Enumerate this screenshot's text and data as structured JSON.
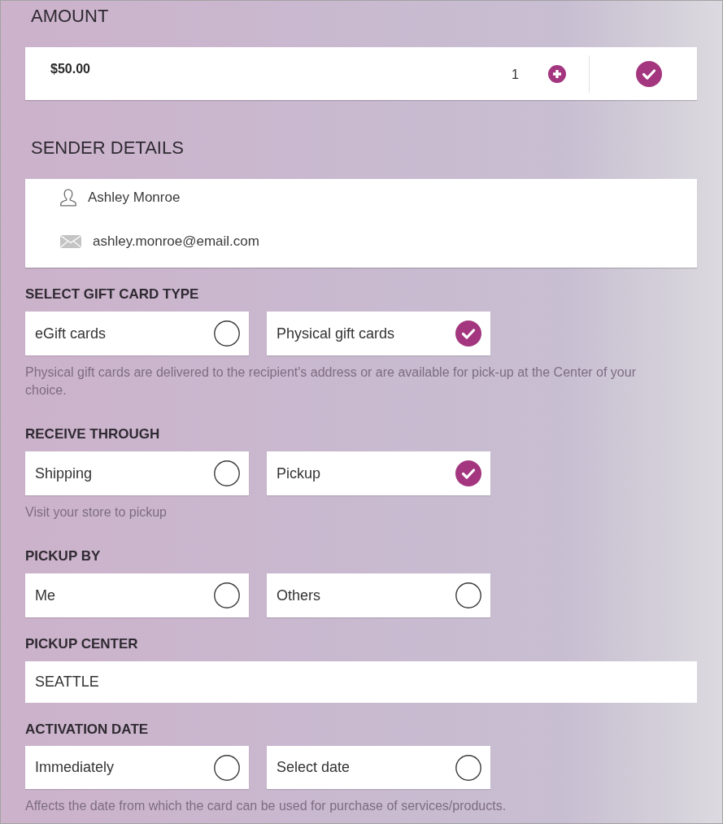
{
  "amount": {
    "heading": "AMOUNT",
    "value": "$50.00",
    "quantity": "1",
    "selected": true
  },
  "sender": {
    "heading": "SENDER DETAILS",
    "name": "Ashley Monroe",
    "email": "ashley.monroe@email.com"
  },
  "sections": [
    {
      "kind": "options",
      "heading": "SELECT GIFT CARD TYPE",
      "options": [
        {
          "label": "eGift cards",
          "selected": false
        },
        {
          "label": "Physical gift cards",
          "selected": true
        }
      ],
      "note": "Physical gift cards are delivered to the recipient's address or are available for pick-up at the Center of your choice."
    },
    {
      "kind": "options",
      "heading": "RECEIVE THROUGH",
      "options": [
        {
          "label": "Shipping",
          "selected": false
        },
        {
          "label": "Pickup",
          "selected": true
        }
      ],
      "note": "Visit your store to pickup"
    },
    {
      "kind": "options",
      "heading": "PICKUP BY",
      "options": [
        {
          "label": "Me",
          "selected": false
        },
        {
          "label": "Others",
          "selected": false
        }
      ]
    },
    {
      "kind": "field",
      "heading": "PICKUP CENTER",
      "value": "SEATTLE"
    },
    {
      "kind": "options",
      "heading": "ACTIVATION DATE",
      "options": [
        {
          "label": "Immediately",
          "selected": false
        },
        {
          "label": "Select date",
          "selected": false
        }
      ],
      "note": "Affects the date from which the card can be used for purchase of services/products."
    }
  ]
}
